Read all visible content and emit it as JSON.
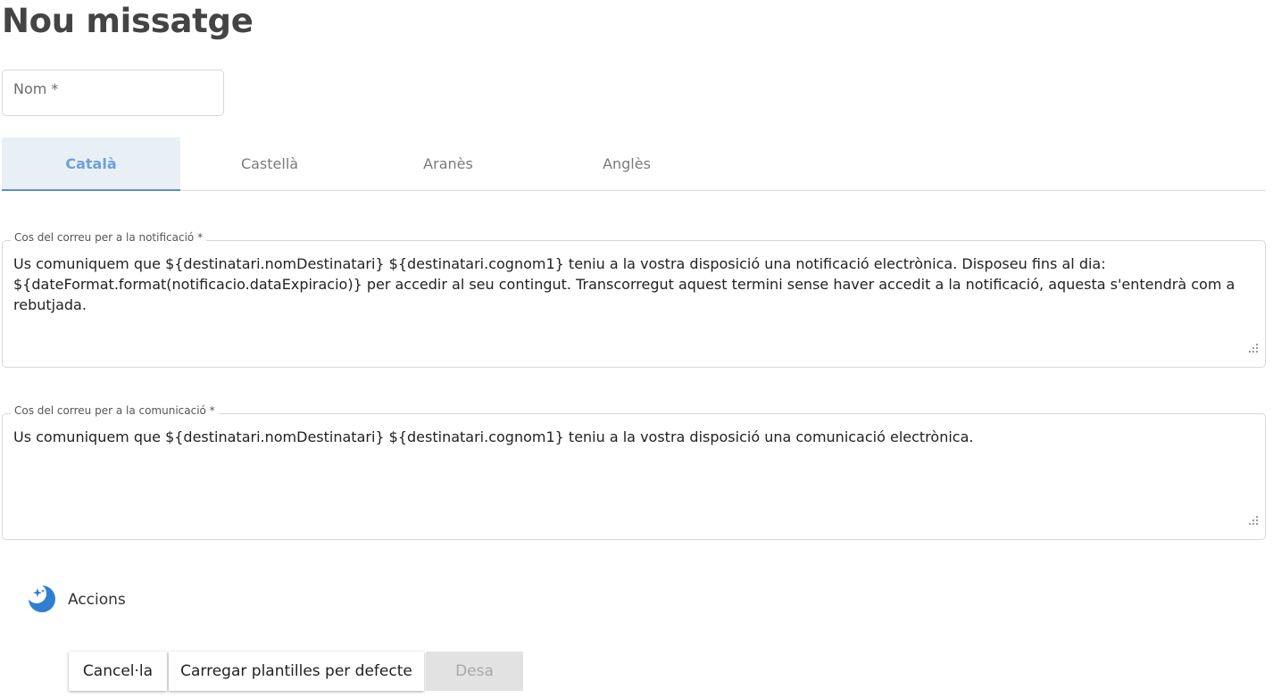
{
  "page": {
    "title": "Nou missatge"
  },
  "form": {
    "name_placeholder": "Nom *"
  },
  "tabs": [
    {
      "label": "Català",
      "active": true
    },
    {
      "label": "Castellà",
      "active": false
    },
    {
      "label": "Aranès",
      "active": false
    },
    {
      "label": "Anglès",
      "active": false
    }
  ],
  "notification_body": {
    "label": "Cos del correu per a la notificació *",
    "value": "Us comuniquem que ${destinatari.nomDestinatari} ${destinatari.cognom1} teniu a la vostra disposició una notificació electrònica. Disposeu fins al dia: ${dateFormat.format(notificacio.dataExpiracio)} per accedir al seu contingut. Transcorregut aquest termini sense haver accedit a la notificació, aquesta s'entendrà com a rebutjada."
  },
  "communication_body": {
    "label": "Cos del correu per a la comunicació *",
    "value": "Us comuniquem que ${destinatari.nomDestinatari} ${destinatari.cognom1} teniu a la vostra disposició una comunicació electrònica."
  },
  "actions": {
    "title": "Accions",
    "icon": "sparkle-moon-icon",
    "cancel_label": "Cancel·la",
    "load_templates_label": "Carregar plantilles per defecte",
    "save_label": "Desa",
    "save_disabled": true
  },
  "colors": {
    "accent": "#5b8fc9",
    "active_tab_bg": "#e9f0f5",
    "active_tab_text": "#6da0d6",
    "actions_icon": "#2f7fd0"
  }
}
